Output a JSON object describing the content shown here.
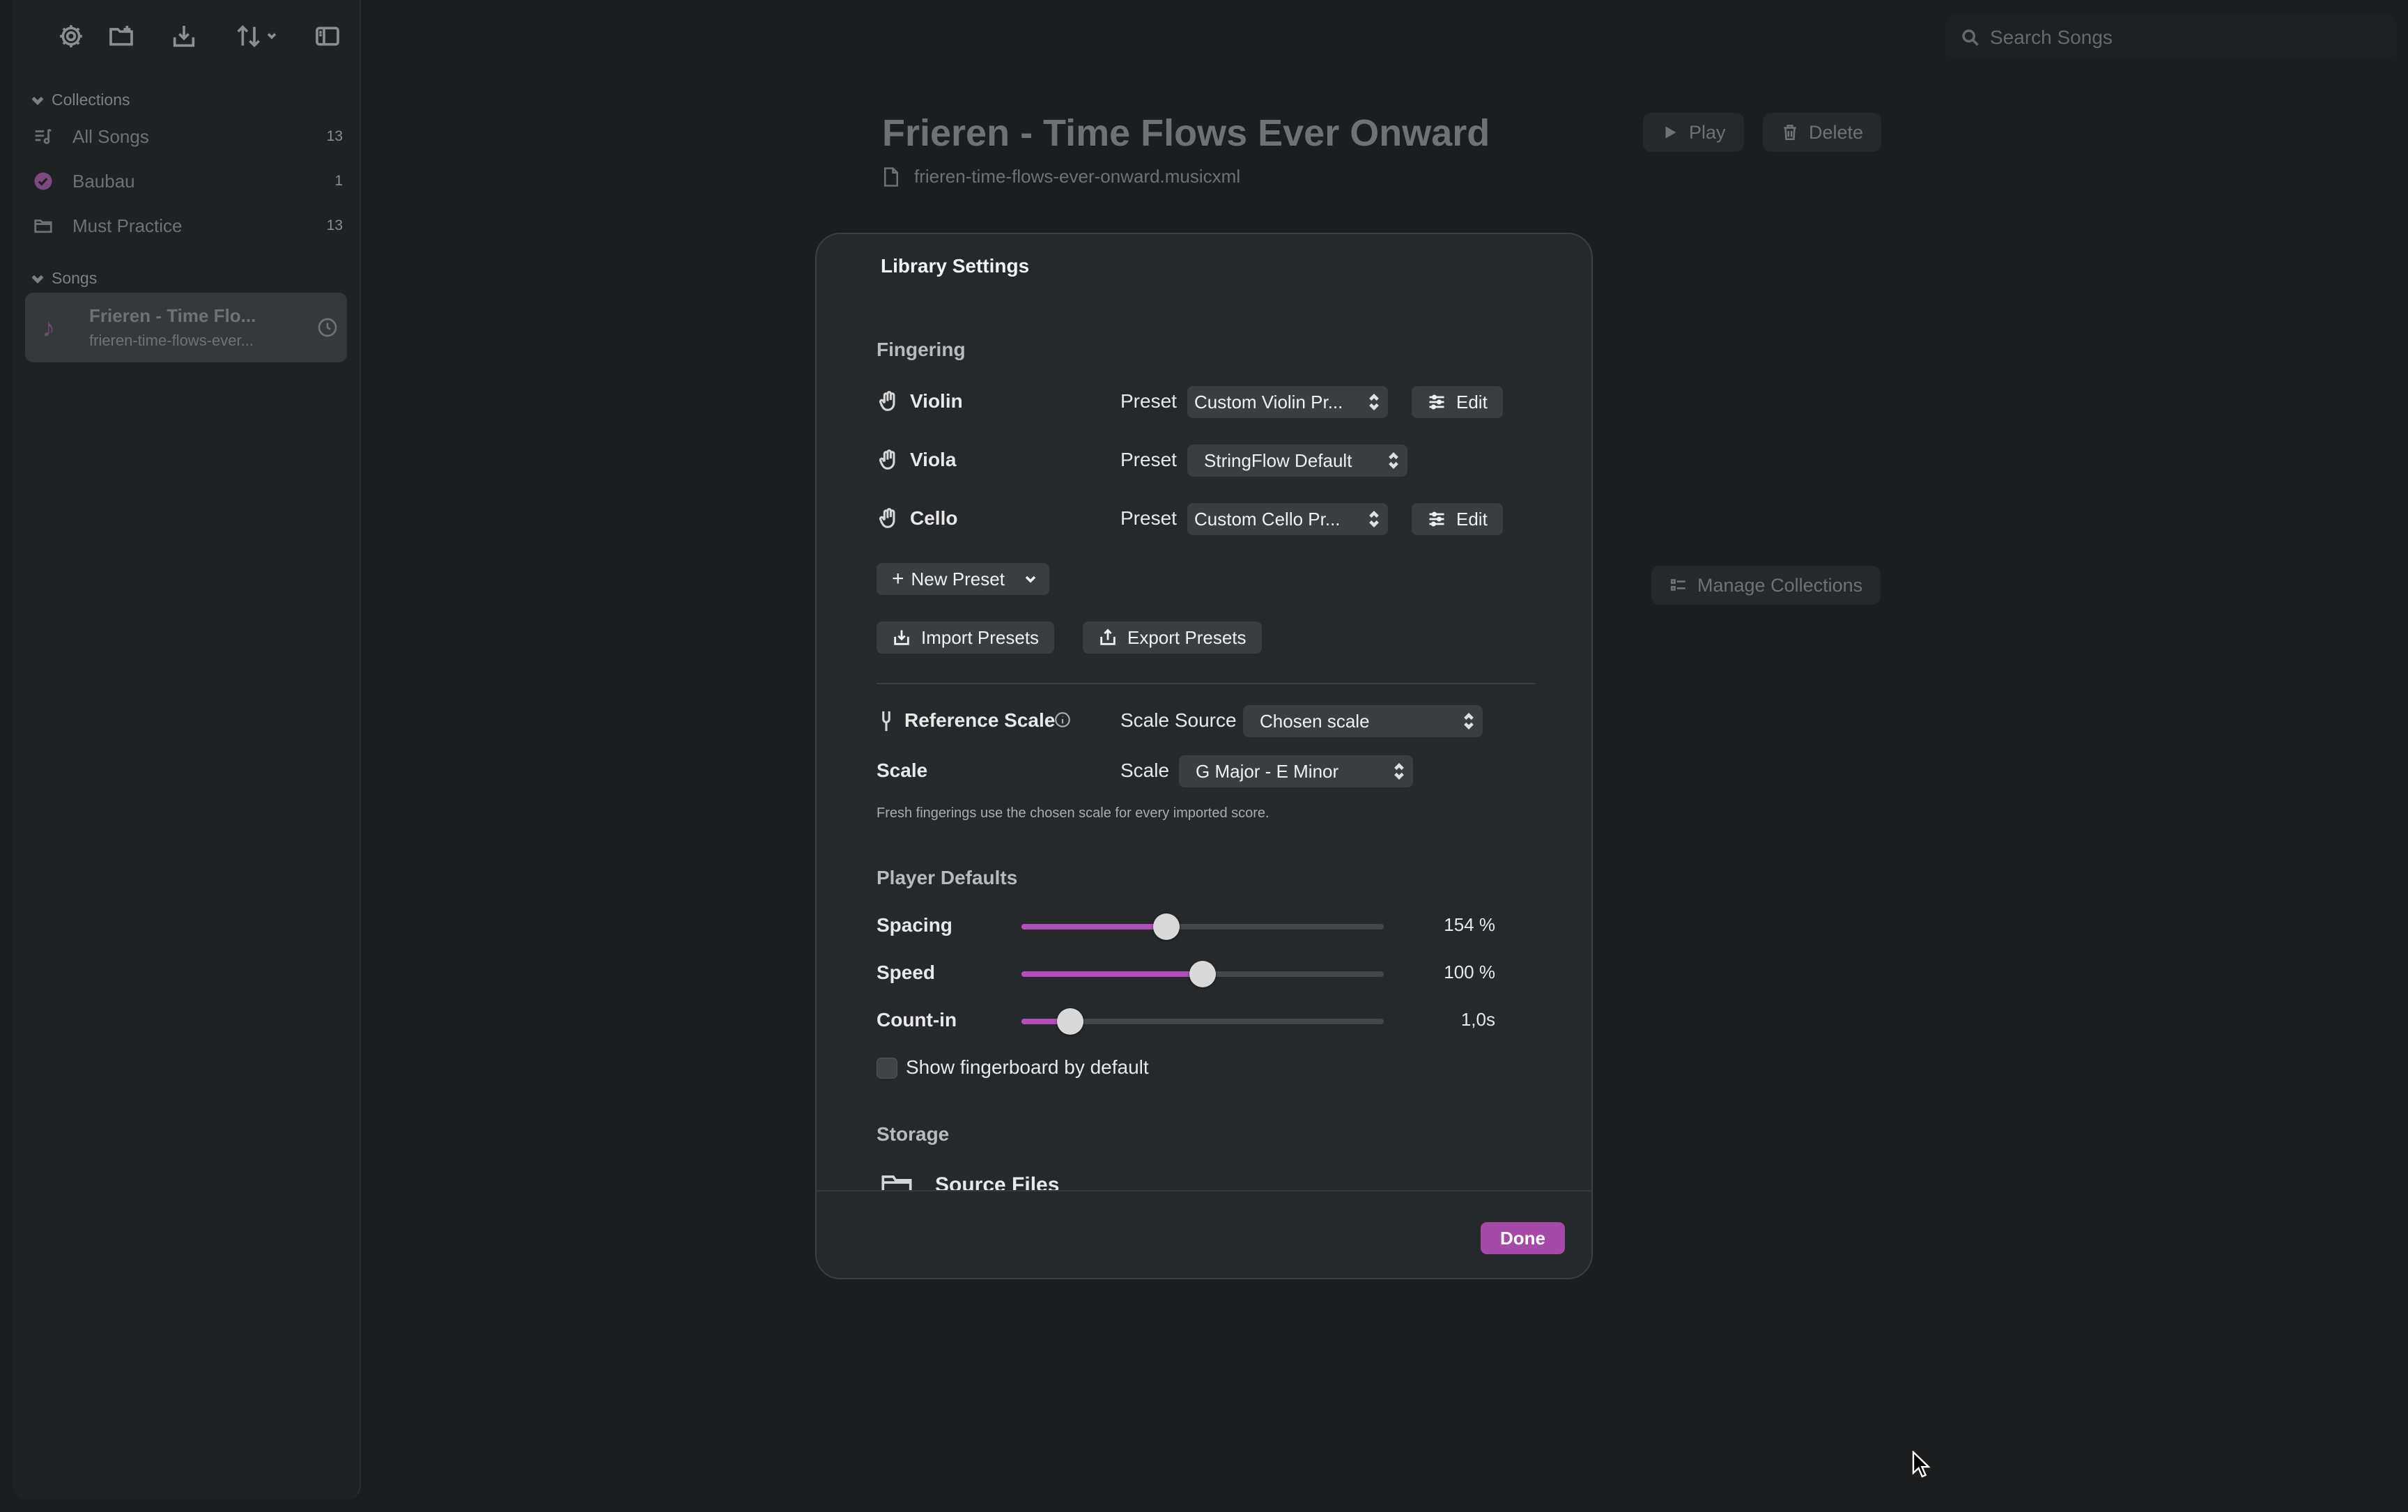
{
  "sidebar": {
    "collections_header": "Collections",
    "songs_header": "Songs",
    "collections": [
      {
        "label": "All Songs",
        "count": "13"
      },
      {
        "label": "Baubau",
        "count": "1"
      },
      {
        "label": "Must Practice",
        "count": "13"
      }
    ],
    "songs": [
      {
        "title": "Frieren - Time Flo...",
        "subtitle": "frieren-time-flows-ever..."
      }
    ]
  },
  "search": {
    "placeholder": "Search Songs"
  },
  "song_detail": {
    "title": "Frieren - Time Flows Ever Onward",
    "filename": "frieren-time-flows-ever-onward.musicxml",
    "play_label": "Play",
    "delete_label": "Delete",
    "manage_collections_label": "Manage Collections"
  },
  "modal": {
    "title": "Library Settings",
    "fingering": {
      "section": "Fingering",
      "preset_label": "Preset",
      "edit_label": "Edit",
      "instruments": [
        {
          "name": "Violin",
          "preset": "Custom Violin Pr..."
        },
        {
          "name": "Viola",
          "preset": "StringFlow Default"
        },
        {
          "name": "Cello",
          "preset": "Custom Cello Pr..."
        }
      ],
      "new_preset": "New Preset",
      "import_presets": "Import Presets",
      "export_presets": "Export Presets"
    },
    "reference_scale": {
      "label": "Reference Scale",
      "source_label": "Scale Source",
      "source_value": "Chosen scale",
      "scale_row_label": "Scale",
      "scale_label": "Scale",
      "scale_value": "G Major - E Minor",
      "hint": "Fresh fingerings use the chosen scale for every imported score."
    },
    "player_defaults": {
      "section": "Player Defaults",
      "sliders": [
        {
          "label": "Spacing",
          "value": "154 %",
          "fraction": 0.4
        },
        {
          "label": "Speed",
          "value": "100 %",
          "fraction": 0.5
        },
        {
          "label": "Count-in",
          "value": "1,0s",
          "fraction": 0.135
        }
      ],
      "show_fingerboard": "Show fingerboard by default",
      "show_fingerboard_checked": false
    },
    "storage": {
      "section": "Storage",
      "source_files": "Source Files"
    },
    "done_label": "Done"
  },
  "colors": {
    "accent": "#a54aa9",
    "slider_fill": "#b14fb8"
  }
}
